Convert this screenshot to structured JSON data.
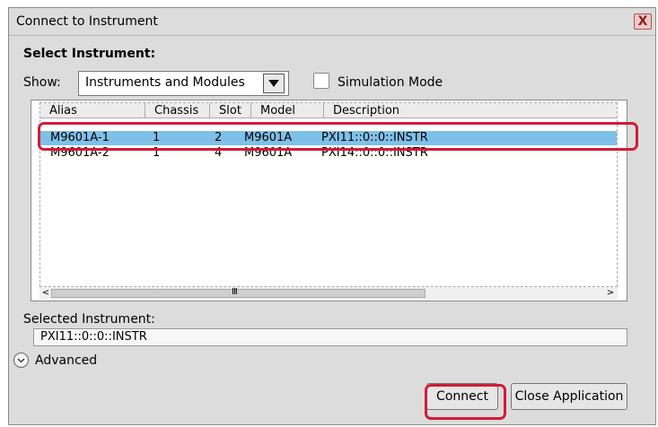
{
  "window": {
    "title": "Connect to Instrument",
    "close_glyph": "X"
  },
  "section_title": "Select Instrument:",
  "show": {
    "label": "Show:",
    "value": "Instruments and Modules"
  },
  "simulation_mode": {
    "label": "Simulation Mode",
    "checked": false
  },
  "table": {
    "columns": [
      "Alias",
      "Chassis",
      "Slot",
      "Model",
      "Description"
    ],
    "rows": [
      {
        "alias": "M9601A-1",
        "chassis": "1",
        "slot": "2",
        "model": "M9601A",
        "description": "PXI11::0::0::INSTR",
        "selected": true
      },
      {
        "alias": "M9601A-2",
        "chassis": "1",
        "slot": "4",
        "model": "M9601A",
        "description": "PXI14::0::0::INSTR",
        "selected": false
      }
    ],
    "scroll_left": "<",
    "scroll_right": ">",
    "scroll_grip": "III"
  },
  "selected_instrument": {
    "label": "Selected Instrument:",
    "value": "PXI11::0::0::INSTR"
  },
  "advanced": {
    "label": "Advanced"
  },
  "buttons": {
    "connect": "Connect",
    "close_application": "Close Application"
  },
  "colors": {
    "highlight": "#d41a3a",
    "selection": "#7fc0e8"
  }
}
